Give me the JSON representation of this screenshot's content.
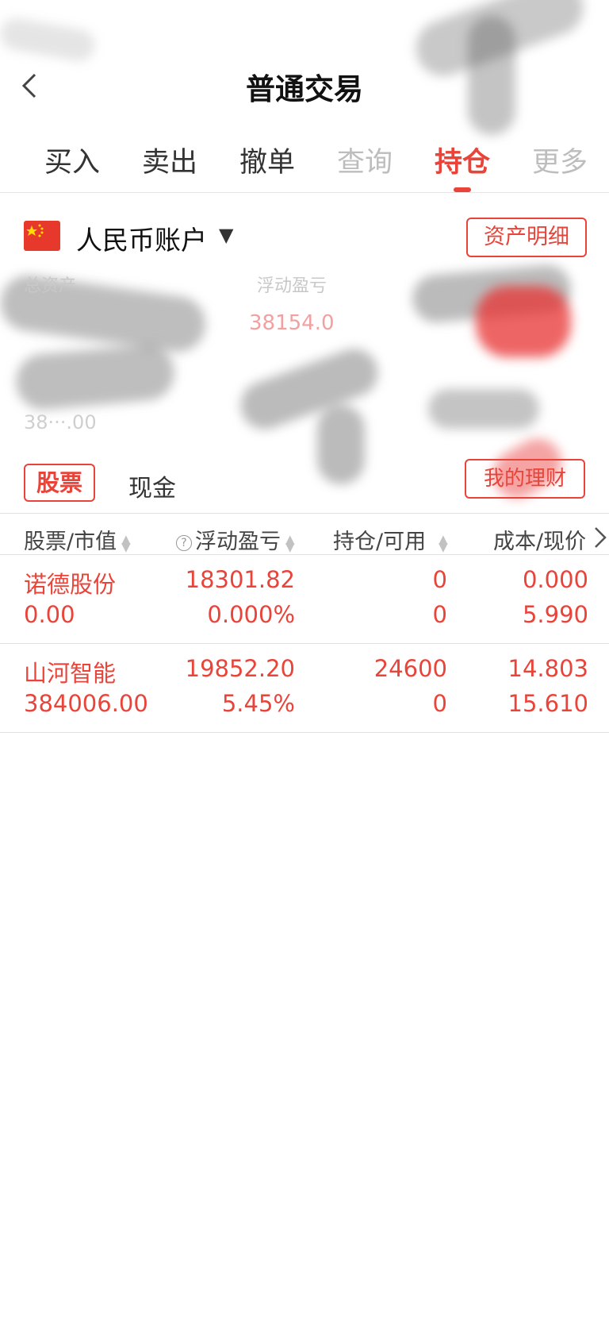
{
  "header": {
    "title": "普通交易"
  },
  "tabs": [
    "买入",
    "卖出",
    "撤单",
    "查询",
    "持仓",
    "更多"
  ],
  "account": {
    "label": "人民币账户",
    "asset_detail_label": "资产明细"
  },
  "summary": {
    "total_assets_label": "总资产",
    "floating_pnl_label": "浮动盈亏",
    "floating_pnl_value": "38154.0",
    "bottom_value": "38···.00"
  },
  "subtabs": {
    "stocks": "股票",
    "cash": "现金",
    "my_finance": "我的理财"
  },
  "table": {
    "columns": [
      "股票/市值",
      "浮动盈亏",
      "持仓/可用",
      "成本/现价"
    ],
    "rows": [
      {
        "name": "诺德股份",
        "market_value": "0.00",
        "pnl": "18301.82",
        "pnl_pct": "0.000%",
        "position": "0",
        "available": "0",
        "cost": "0.000",
        "price": "5.990"
      },
      {
        "name": "山河智能",
        "market_value": "384006.00",
        "pnl": "19852.20",
        "pnl_pct": "5.45%",
        "position": "24600",
        "available": "0",
        "cost": "14.803",
        "price": "15.610"
      }
    ]
  },
  "colors": {
    "accent": "#e8443a",
    "text": "#222222",
    "divider": "#e2e2e2"
  },
  "icons": {
    "back": "chevron-left-icon",
    "flag": "china-flag-icon",
    "help": "question-circle-icon"
  }
}
